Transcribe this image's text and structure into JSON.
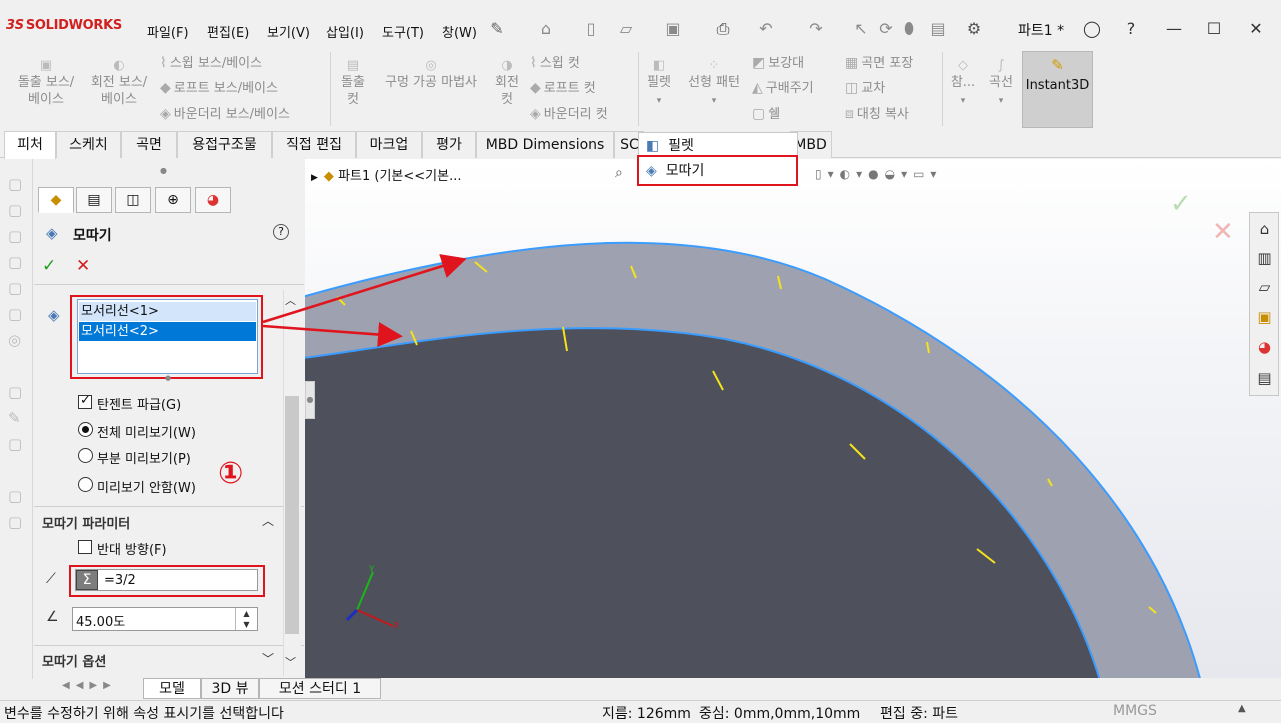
{
  "app": {
    "brand_mark": "3S",
    "brand": "SOLIDWORKS",
    "doc_title": "파트1 *",
    "menu": [
      "파일(F)",
      "편집(E)",
      "보기(V)",
      "삽입(I)",
      "도구(T)",
      "창(W)"
    ],
    "pin_icon": "pin-icon"
  },
  "ribbon": {
    "extrude_boss": "돌출 보스/\n베이스",
    "revolve_boss": "회전 보스/\n베이스",
    "sweep_boss": "스윕 보스/베이스",
    "loft_boss": "로프트 보스/베이스",
    "boundary_boss": "바운더리 보스/베이스",
    "extrude_cut": "돌출\n컷",
    "hole_wizard": "구멍 가공 마법사",
    "revolve_cut": "회전\n컷",
    "sweep_cut": "스윕 컷",
    "loft_cut": "로프트 컷",
    "boundary_cut": "바운더리 컷",
    "fillet": "필렛",
    "linear_pattern": "선형 패턴",
    "rib": "보강대",
    "draft": "구배주기",
    "shell": "쉘",
    "wrap": "곡면 포장",
    "intersect": "교차",
    "mirror": "대칭 복사",
    "ref": "참...",
    "curves": "곡선",
    "instant3d": "Instant3D"
  },
  "tabs": [
    "피처",
    "스케치",
    "곡면",
    "용접구조물",
    "직접 편집",
    "마크업",
    "평가",
    "MBD Dimensions",
    "SC",
    "MBD"
  ],
  "dropdown": {
    "items": [
      "필렛",
      "모따기"
    ]
  },
  "tree": {
    "root": "파트1  (기본<<기본..."
  },
  "property_manager": {
    "title": "모따기",
    "help": "?",
    "ok": "✓",
    "cancel": "✕",
    "edges": [
      "모서리선<1>",
      "모서리선<2>"
    ],
    "tangent_propagation": "탄젠트 파급(G)",
    "tangent_checked": true,
    "preview_options": [
      "전체 미리보기(W)",
      "부분 미리보기(P)",
      "미리보기 안함(W)"
    ],
    "preview_selected": 0,
    "annotation_number": "①",
    "params_section": "모따기 파라미터",
    "reverse_direction": "반대 방향(F)",
    "reverse_checked": false,
    "distance_value": "=3/2",
    "angle_value": "45.00도",
    "options_section": "모따기 옵션"
  },
  "bottom_tabs": [
    "모델",
    "3D 뷰",
    "모션 스터디 1"
  ],
  "status": {
    "message": "변수를 수정하기 위해 속성 표시기를 선택합니다",
    "diameter": "지름: 126mm",
    "center": "중심: 0mm,0mm,10mm",
    "editing": "편집 중: 파트",
    "units": "MMGS"
  },
  "colors": {
    "annotation_red": "#e0141c",
    "selection_blue": "#0078d7",
    "edge_blue": "#3b9cff",
    "brand_red": "#d21f1f"
  }
}
